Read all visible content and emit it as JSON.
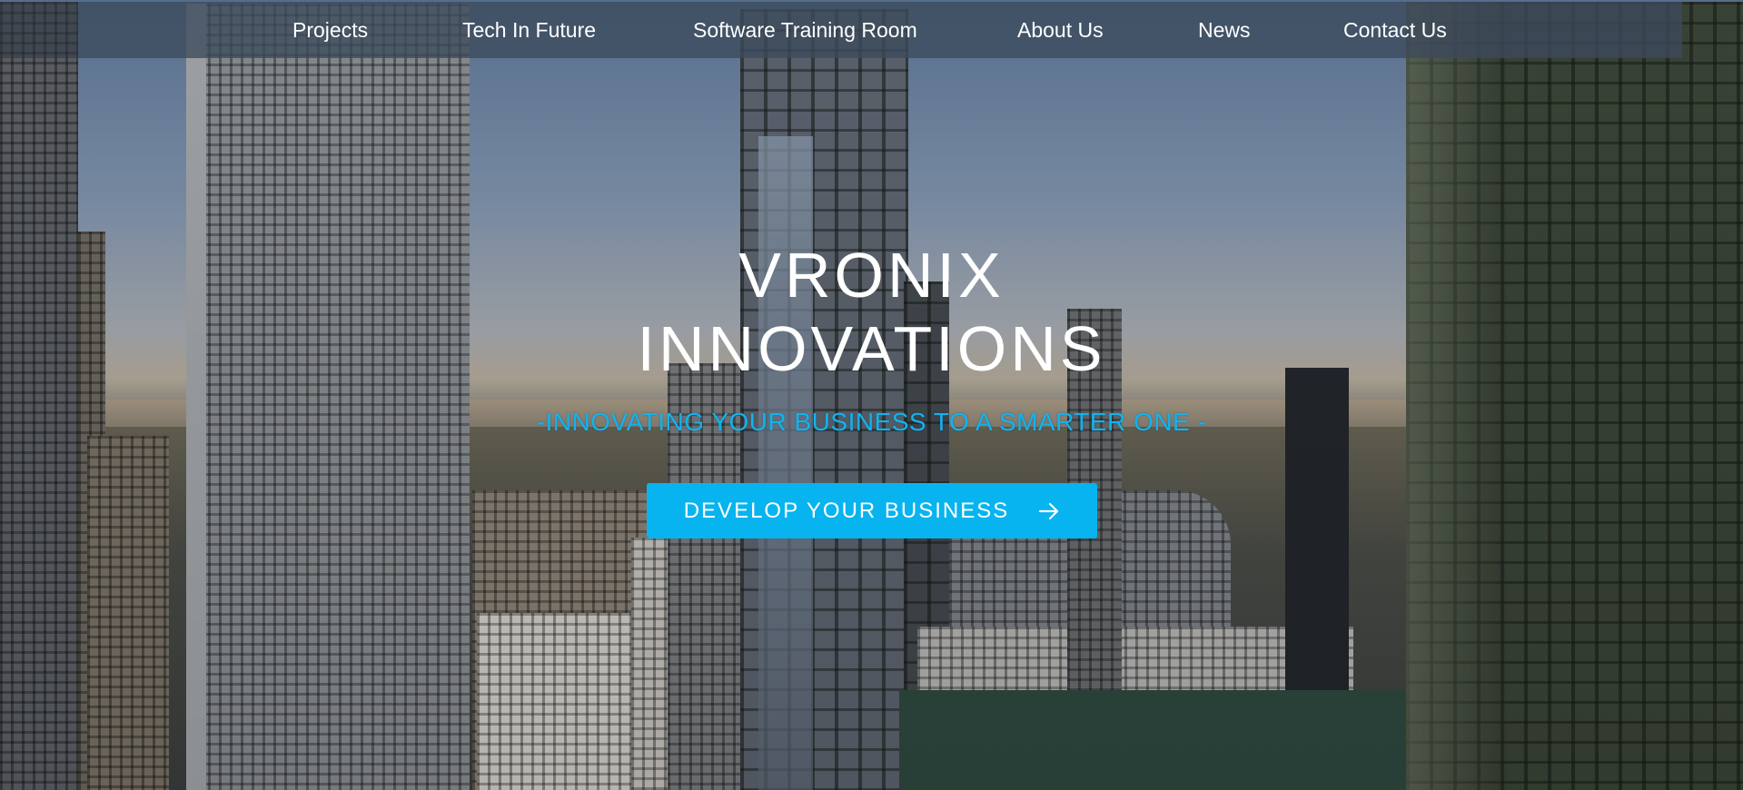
{
  "nav": {
    "items": [
      {
        "label": "Projects"
      },
      {
        "label": "Tech In Future"
      },
      {
        "label": "Software Training Room"
      },
      {
        "label": "About Us"
      },
      {
        "label": "News"
      },
      {
        "label": "Contact Us"
      }
    ]
  },
  "hero": {
    "title_line1": "VRONIX",
    "title_line2": "INNOVATIONS",
    "tagline": "-INNOVATING YOUR BUSINESS TO A SMARTER ONE -",
    "cta_label": "DEVELOP YOUR BUSINESS",
    "cta_icon": "arrow-right-icon"
  },
  "colors": {
    "accent": "#07b4ef",
    "tagline": "#12b3ee",
    "nav_bar": "#3c4a5c",
    "text": "#ffffff"
  }
}
